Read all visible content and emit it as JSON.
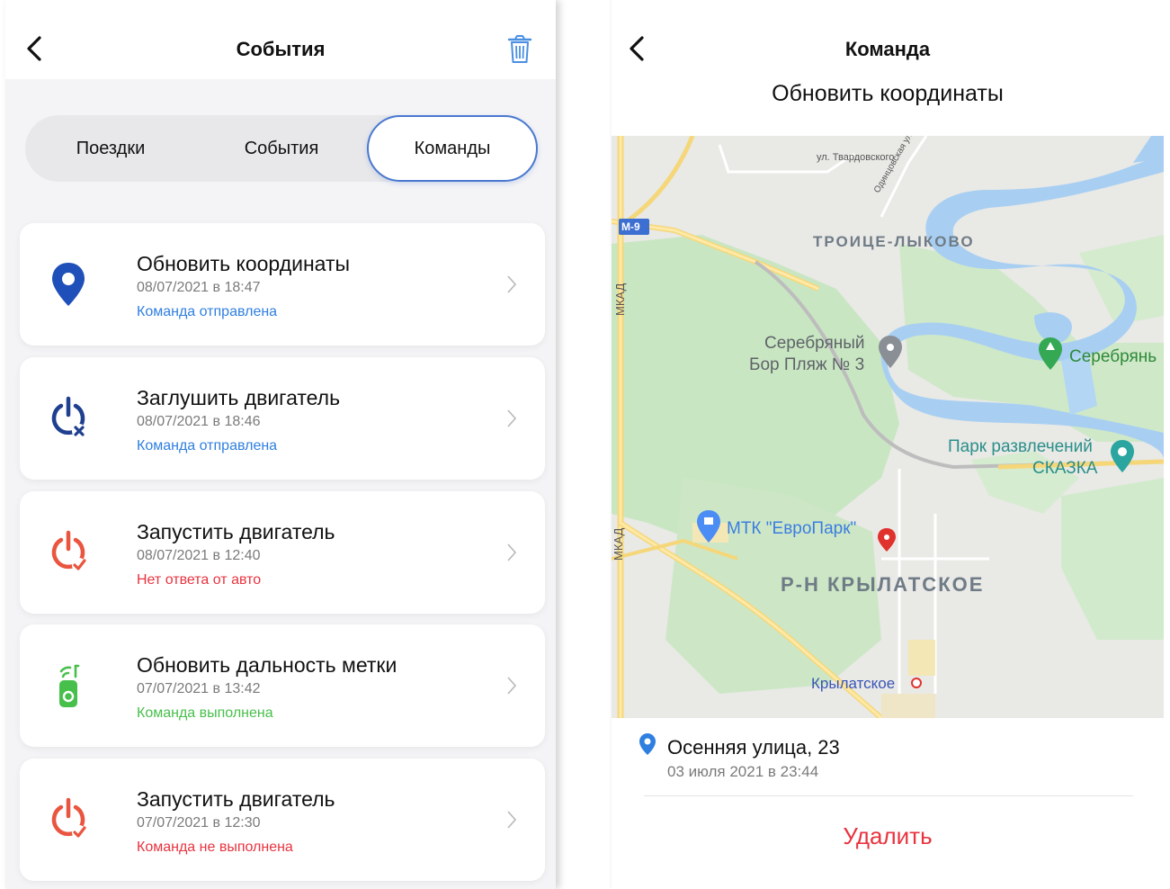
{
  "left": {
    "header": {
      "title": "События"
    },
    "tabs": [
      {
        "label": "Поездки"
      },
      {
        "label": "События"
      },
      {
        "label": "Команды"
      }
    ],
    "active_tab": "Команды",
    "commands": [
      {
        "title": "Обновить координаты",
        "date": "08/07/2021 в 18:47",
        "status": "Команда отправлена",
        "status_color": "#2f7fe0",
        "icon": "location-pin-icon"
      },
      {
        "title": "Заглушить двигатель",
        "date": "08/07/2021 в 18:46",
        "status": "Команда отправлена",
        "status_color": "#2f7fe0",
        "icon": "engine-off-icon"
      },
      {
        "title": "Запустить двигатель",
        "date": "08/07/2021 в 12:40",
        "status": " Нет ответа от авто",
        "status_color": "#e8333f",
        "icon": "engine-start-icon"
      },
      {
        "title": "Обновить дальность метки",
        "date": "07/07/2021 в 13:42",
        "status": "Команда выполнена",
        "status_color": "#47c04b",
        "icon": "tag-range-icon"
      },
      {
        "title": "Запустить двигатель",
        "date": "07/07/2021 в 12:30",
        "status": "Команда не выполнена",
        "status_color": "#e8333f",
        "icon": "engine-start-icon"
      }
    ]
  },
  "right": {
    "title": "Команда",
    "subtitle": "Обновить координаты",
    "map_labels": {
      "street1": "ул. Твардовского",
      "street2": "Одинцовская ул.",
      "road_m9": "М-9",
      "mkad1": "МКАД",
      "mkad2": "МКАД",
      "district1": "ТРОИЦЕ-ЛЫКОВО",
      "beach_line1": "Серебряный",
      "beach_line2": "Бор Пляж № 3",
      "forest": "Серебрянь",
      "park_line1": "Парк развлечений",
      "park_line2": "СКАЗКА",
      "mall": "МТК \"ЕвроПарк\"",
      "district2": "Р-Н КРЫЛАТСКОЕ",
      "metro": "Крылатское"
    },
    "address": "Осенняя улица, 23",
    "address_date": "03 июля 2021 в 23:44",
    "delete_label": "Удалить"
  }
}
